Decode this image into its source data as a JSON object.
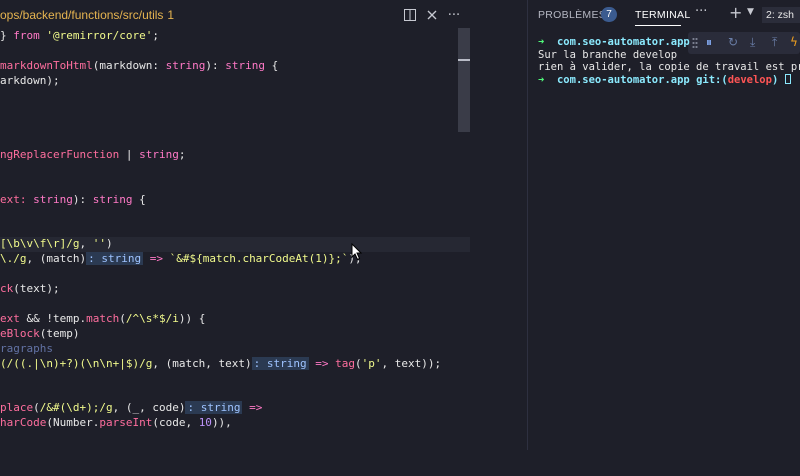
{
  "editor": {
    "tab": {
      "path": "ops/backend/functions/src/utils",
      "badge": "1"
    },
    "actions": {
      "split_icon": "split-editor-icon",
      "close_icon": "close-icon",
      "more_icon": "more-icon"
    },
    "lines": [
      [
        {
          "t": "} ",
          "c": "pl"
        },
        {
          "t": "from",
          "c": "kw"
        },
        {
          "t": " ",
          "c": "pl"
        },
        {
          "t": "'@remirror/core'",
          "c": "str"
        },
        {
          "t": ";",
          "c": "pl"
        }
      ],
      [
        {
          "t": "",
          "c": "pl"
        }
      ],
      [
        {
          "t": "markdownToHtml",
          "c": "fn"
        },
        {
          "t": "(markdown: ",
          "c": "pl"
        },
        {
          "t": "string",
          "c": "ty"
        },
        {
          "t": "): ",
          "c": "pl"
        },
        {
          "t": "string",
          "c": "ty"
        },
        {
          "t": " {",
          "c": "pl"
        }
      ],
      [
        {
          "t": "arkdown);",
          "c": "pl"
        }
      ],
      [
        {
          "t": "",
          "c": "pl"
        }
      ],
      [
        {
          "t": "",
          "c": "pl"
        }
      ],
      [
        {
          "t": "",
          "c": "pl"
        }
      ],
      [
        {
          "t": "",
          "c": "pl"
        }
      ],
      [
        {
          "t": "ngReplacerFunction",
          "c": "fn"
        },
        {
          "t": " | ",
          "c": "pl"
        },
        {
          "t": "string",
          "c": "ty"
        },
        {
          "t": ";",
          "c": "pl"
        }
      ],
      [
        {
          "t": "",
          "c": "pl"
        }
      ],
      [
        {
          "t": "",
          "c": "pl"
        }
      ],
      [
        {
          "t": "ext: ",
          "c": "fn"
        },
        {
          "t": "string",
          "c": "ty"
        },
        {
          "t": "): ",
          "c": "pl"
        },
        {
          "t": "string",
          "c": "ty"
        },
        {
          "t": " {",
          "c": "pl"
        }
      ],
      [
        {
          "t": "",
          "c": "pl"
        }
      ],
      [
        {
          "t": "",
          "c": "pl"
        }
      ],
      [
        {
          "t": "[\\b\\v\\f\\r]/g",
          "c": "rx"
        },
        {
          "t": ", ",
          "c": "pl"
        },
        {
          "t": "''",
          "c": "str"
        },
        {
          "t": ")",
          "c": "pl"
        }
      ],
      [
        {
          "t": "\\./g",
          "c": "rx"
        },
        {
          "t": ", (match)",
          "c": "pl"
        },
        {
          "t": ": string",
          "c": "hint"
        },
        {
          "t": " => ",
          "c": "kw"
        },
        {
          "t": "`&#${match.charCodeAt(1)};`",
          "c": "str"
        },
        {
          "t": ");",
          "c": "pl"
        }
      ],
      [
        {
          "t": "",
          "c": "pl"
        }
      ],
      [
        {
          "t": "ck",
          "c": "fn"
        },
        {
          "t": "(text);",
          "c": "pl"
        }
      ],
      [
        {
          "t": "",
          "c": "pl"
        }
      ],
      [
        {
          "t": "ext",
          "c": "fn"
        },
        {
          "t": " && !temp.",
          "c": "pl"
        },
        {
          "t": "match",
          "c": "fn"
        },
        {
          "t": "(",
          "c": "pl"
        },
        {
          "t": "/^\\s*$/i",
          "c": "rx"
        },
        {
          "t": ")) {",
          "c": "pl"
        }
      ],
      [
        {
          "t": "eBlock",
          "c": "fn"
        },
        {
          "t": "(temp)",
          "c": "pl"
        }
      ],
      [
        {
          "t": "ragraphs",
          "c": "cm"
        }
      ],
      [
        {
          "t": "(/((.|\\n)+?)(\\n\\n+|$)/g",
          "c": "rx"
        },
        {
          "t": ", (match, text)",
          "c": "pl"
        },
        {
          "t": ": string",
          "c": "hint"
        },
        {
          "t": " => ",
          "c": "kw"
        },
        {
          "t": "tag",
          "c": "fn"
        },
        {
          "t": "(",
          "c": "pl"
        },
        {
          "t": "'p'",
          "c": "str"
        },
        {
          "t": ", text));",
          "c": "pl"
        }
      ],
      [
        {
          "t": "",
          "c": "pl"
        }
      ],
      [
        {
          "t": "",
          "c": "pl"
        }
      ],
      [
        {
          "t": "place",
          "c": "fn"
        },
        {
          "t": "(",
          "c": "pl"
        },
        {
          "t": "/&#(\\d+);/g",
          "c": "rx"
        },
        {
          "t": ", (_, code)",
          "c": "pl"
        },
        {
          "t": ": string",
          "c": "hint"
        },
        {
          "t": " =>",
          "c": "kw"
        }
      ],
      [
        {
          "t": "harCode",
          "c": "fn"
        },
        {
          "t": "(Number.",
          "c": "pl"
        },
        {
          "t": "parseInt",
          "c": "fn"
        },
        {
          "t": "(code, ",
          "c": "pl"
        },
        {
          "t": "10",
          "c": "num"
        },
        {
          "t": ")),",
          "c": "pl"
        }
      ],
      [
        {
          "t": "",
          "c": "pl"
        }
      ],
      [
        {
          "t": "",
          "c": "pl"
        }
      ],
      [
        {
          "t": "",
          "c": "pl"
        }
      ]
    ],
    "highlighted_line": 14
  },
  "panel": {
    "tab_problems": "PROBLÈMES",
    "problems_count": "7",
    "tab_terminal": "TERMINAL",
    "more_icon": "more-icon",
    "add_icon": "plus-icon",
    "dropdown_icon": "chevron-down-icon",
    "terminal_select": "2: zsh",
    "debug_toolbar": [
      "drag-handle-icon",
      "pause-icon",
      "restart-icon",
      "step-into-icon",
      "step-out-icon",
      "bolt-icon"
    ]
  },
  "terminal": {
    "line1_arrow": "➜",
    "line1_host": "com.seo-automator.app",
    "line2": "Sur la branche develop",
    "line3": "rien à valider, la copie de travail est propre",
    "line4_arrow": "➜",
    "line4_host": "com.seo-automator.app",
    "line4_git": "git:(",
    "line4_branch": "develop",
    "line4_git_close": ")"
  },
  "colors": {
    "background": "#1e1f29",
    "accent": "#e6b450",
    "terminal_green": "#50fa7b",
    "terminal_cyan": "#8be9fd",
    "terminal_red": "#ff5555"
  }
}
